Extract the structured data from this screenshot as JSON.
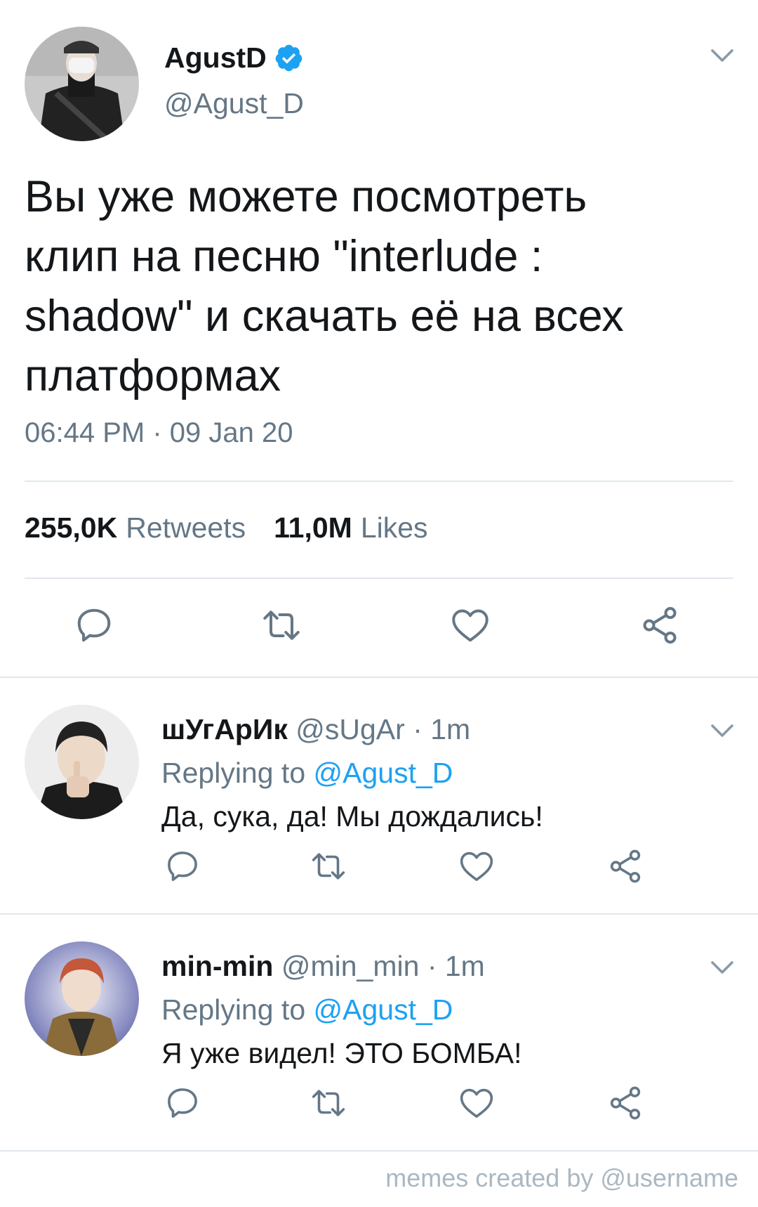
{
  "main_tweet": {
    "name": "AgustD",
    "handle": "@Agust_D",
    "text_lines": [
      "Вы уже можете посмотреть",
      "клип на песню \"interlude :",
      "shadow\" и скачать её на всех",
      "платформах"
    ],
    "timestamp": "06:44 PM · 09 Jan 20",
    "retweets_count": "255,0K",
    "retweets_label": "Retweets",
    "likes_count": "11,0M",
    "likes_label": "Likes"
  },
  "replies": [
    {
      "name": "шУгАрИк",
      "handle": "@sUgAr",
      "time": "· 1m",
      "replying_prefix": "Replying to",
      "replying_handle": "@Agust_D",
      "text": "Да, сука, да! Мы дождались!"
    },
    {
      "name": "min-min",
      "handle": "@min_min",
      "time": "· 1m",
      "replying_prefix": "Replying to",
      "replying_handle": "@Agust_D",
      "text": "Я уже видел! ЭТО БОМБА!"
    }
  ],
  "watermark": "memes created by @username",
  "icons": {
    "verified": "verified-badge-icon",
    "reply": "reply-icon",
    "retweet": "retweet-icon",
    "like": "like-icon",
    "share": "share-icon",
    "menu": "chevron-down-icon"
  },
  "colors": {
    "verified_blue": "#1da1f2",
    "link_blue": "#1da1f2",
    "secondary_text": "#657786",
    "icon_gray": "#657786",
    "divider": "#e1e8ed"
  }
}
